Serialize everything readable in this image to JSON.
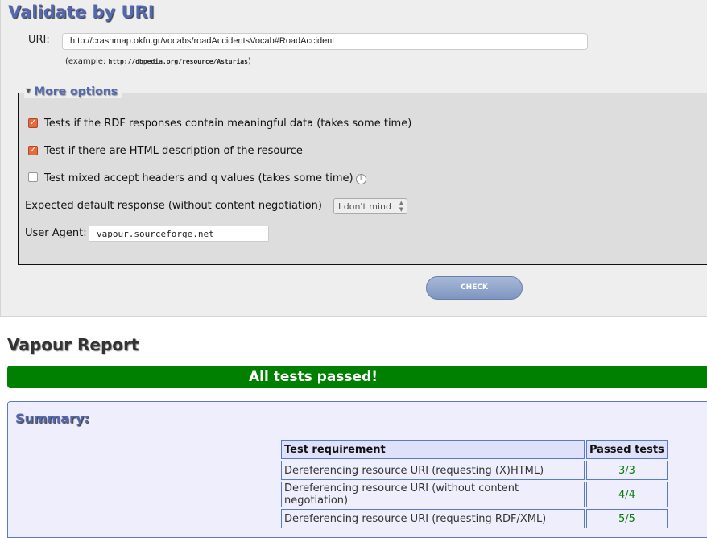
{
  "form": {
    "title": "Validate by URI",
    "uri_label": "URI:",
    "uri_value": "http://crashmap.okfn.gr/vocabs/roadAccidentsVocab#RoadAccident",
    "example_prefix": "(example: ",
    "example_uri": "http://dbpedia.org/resource/Asturias",
    "example_suffix": ")"
  },
  "options": {
    "legend": "More options",
    "items": [
      {
        "label": "Tests if the RDF responses contain meaningful data (takes some time)",
        "checked": true
      },
      {
        "label": "Test if there are HTML description of the resource",
        "checked": true
      },
      {
        "label": "Test mixed accept headers and q values (takes some time)",
        "checked": false
      }
    ],
    "default_label": "Expected default response (without content negotiation)",
    "default_value": "I don't mind",
    "ua_label": "User Agent:",
    "ua_value": "vapour.sourceforge.net"
  },
  "check_label": "CHECK",
  "report": {
    "title": "Vapour Report",
    "status": "All tests passed!",
    "status_color": "#008000",
    "summary_title": "Summary:",
    "headers": [
      "Test requirement",
      "Passed tests"
    ],
    "rows": [
      [
        "Dereferencing resource URI (requesting (X)HTML)",
        "3/3"
      ],
      [
        "Dereferencing resource URI (without content negotiation)",
        "4/4"
      ],
      [
        "Dereferencing resource URI (requesting RDF/XML)",
        "5/5"
      ]
    ]
  }
}
